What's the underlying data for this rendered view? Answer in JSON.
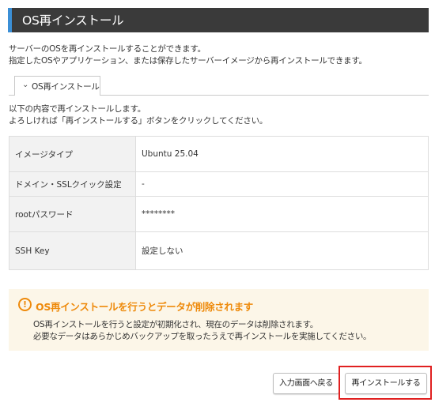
{
  "header": {
    "title": "OS再インストール",
    "accent_color": "#3b8fd6"
  },
  "intro": {
    "line1": "サーバーのOSを再インストールすることができます。",
    "line2": "指定したOSやアプリケーション、または保存したサーバーイメージから再インストールできます。"
  },
  "tab": {
    "icon": "chevron-down-icon",
    "label": "OS再インストール"
  },
  "lead": {
    "line1": "以下の内容で再インストールします。",
    "line2": "よろしければ「再インストールする」ボタンをクリックしてください。"
  },
  "details": {
    "rows": [
      {
        "label": "イメージタイプ",
        "value": "Ubuntu 25.04"
      },
      {
        "label": "ドメイン・SSLクイック設定",
        "value": "-"
      },
      {
        "label": "rootパスワード",
        "value": "********"
      },
      {
        "label": "SSH Key",
        "value": "設定しない"
      }
    ]
  },
  "warning": {
    "icon": "exclamation-circle-icon",
    "title": "OS再インストールを行うとデータが削除されます",
    "line1": "OS再インストールを行うと設定が初期化され、現在のデータは削除されます。",
    "line2": "必要なデータはあらかじめバックアップを取ったうえで再インストールを実施してください。",
    "color": "#ee8a0b"
  },
  "actions": {
    "back_label": "入力画面へ戻る",
    "submit_label": "再インストールする",
    "highlight_color": "#e02020"
  }
}
